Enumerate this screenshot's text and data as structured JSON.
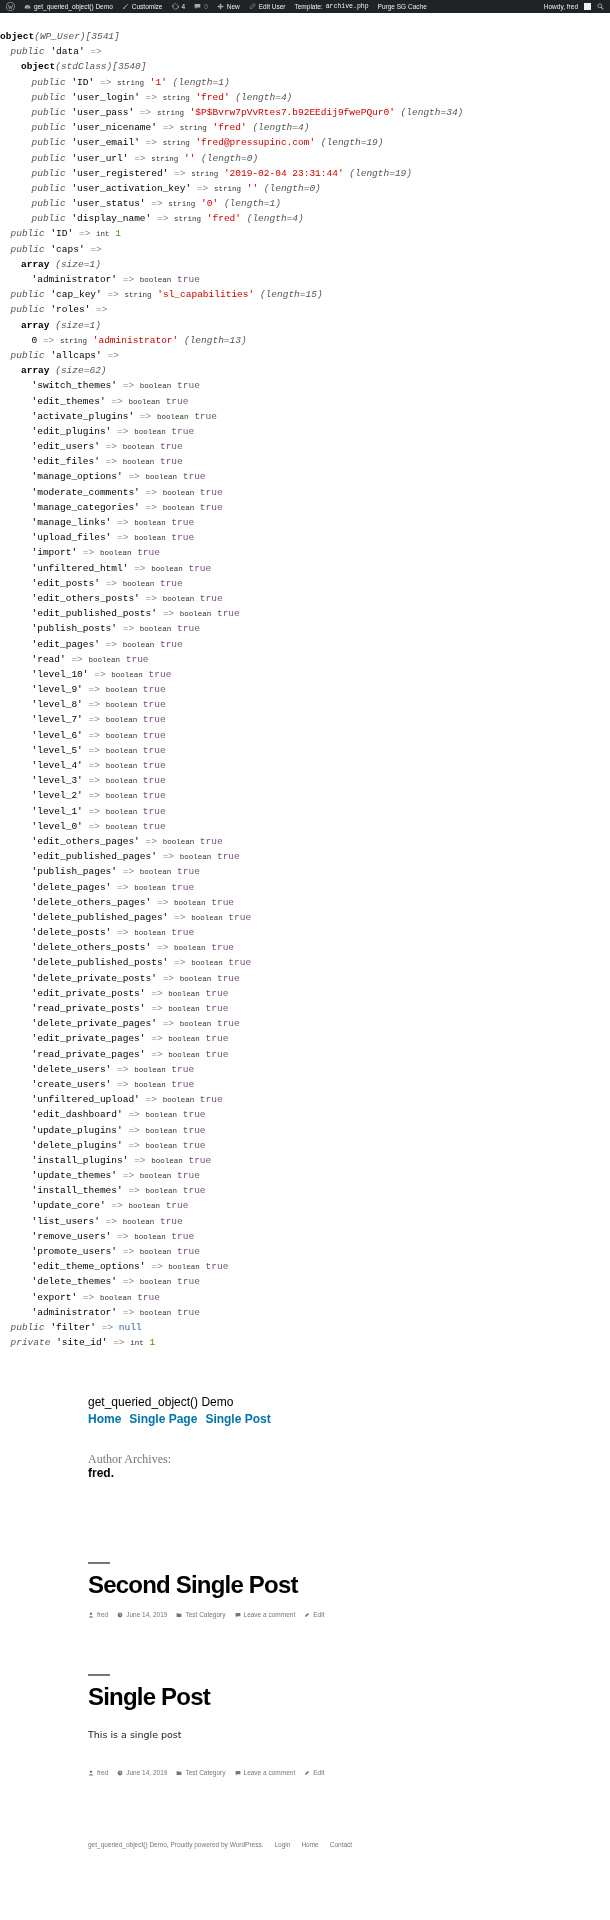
{
  "admin_bar": {
    "items": [
      {
        "kind": "logo"
      },
      {
        "kind": "site",
        "label": "get_queried_object() Demo"
      },
      {
        "kind": "customize",
        "label": "Customize"
      },
      {
        "kind": "updates",
        "label": "4"
      },
      {
        "kind": "comments",
        "label": "0"
      },
      {
        "kind": "new",
        "label": "New"
      },
      {
        "kind": "edit",
        "label": "Edit User"
      },
      {
        "kind": "template",
        "label": "Template:",
        "file": "archive.php"
      },
      {
        "kind": "purge",
        "label": "Purge SG Cache"
      }
    ],
    "greeting": "Howdy, fred"
  },
  "dump": [
    {
      "head": "object",
      "class": "(WP_User)",
      "ref": "[3541]",
      "children": [
        {
          "visibility": "public",
          "key": "'data'",
          "arrow": "=>",
          "children": [
            {
              "head": "object",
              "class": "(stdClass)",
              "ref": "[3540]",
              "children": [
                {
                  "visibility": "public",
                  "key": "'ID'",
                  "arrow": "=>",
                  "type": "string",
                  "value": "'1'",
                  "kind": "string",
                  "note": "(length=1)"
                },
                {
                  "visibility": "public",
                  "key": "'user_login'",
                  "arrow": "=>",
                  "type": "string",
                  "value": "'fred'",
                  "kind": "string",
                  "note": "(length=4)"
                },
                {
                  "visibility": "public",
                  "key": "'user_pass'",
                  "arrow": "=>",
                  "type": "string",
                  "value": "'$P$Bvrw7pVvRtes7.b92EEdij9fwePQur0'",
                  "kind": "string",
                  "note": "(length=34)"
                },
                {
                  "visibility": "public",
                  "key": "'user_nicename'",
                  "arrow": "=>",
                  "type": "string",
                  "value": "'fred'",
                  "kind": "string",
                  "note": "(length=4)"
                },
                {
                  "visibility": "public",
                  "key": "'user_email'",
                  "arrow": "=>",
                  "type": "string",
                  "value": "'fred@pressupinc.com'",
                  "kind": "string",
                  "note": "(length=19)"
                },
                {
                  "visibility": "public",
                  "key": "'user_url'",
                  "arrow": "=>",
                  "type": "string",
                  "value": "''",
                  "kind": "string",
                  "note": "(length=0)"
                },
                {
                  "visibility": "public",
                  "key": "'user_registered'",
                  "arrow": "=>",
                  "type": "string",
                  "value": "'2019-02-04 23:31:44'",
                  "kind": "string",
                  "note": "(length=19)"
                },
                {
                  "visibility": "public",
                  "key": "'user_activation_key'",
                  "arrow": "=>",
                  "type": "string",
                  "value": "''",
                  "kind": "string",
                  "note": "(length=0)"
                },
                {
                  "visibility": "public",
                  "key": "'user_status'",
                  "arrow": "=>",
                  "type": "string",
                  "value": "'0'",
                  "kind": "string",
                  "note": "(length=1)"
                },
                {
                  "visibility": "public",
                  "key": "'display_name'",
                  "arrow": "=>",
                  "type": "string",
                  "value": "'fred'",
                  "kind": "string",
                  "note": "(length=4)"
                }
              ]
            }
          ]
        },
        {
          "visibility": "public",
          "key": "'ID'",
          "arrow": "=>",
          "type": "int",
          "value": "1",
          "kind": "int"
        },
        {
          "visibility": "public",
          "key": "'caps'",
          "arrow": "=>",
          "children": [
            {
              "head": "array",
              "note": "(size=1)",
              "children": [
                {
                  "key": "'administrator'",
                  "arrow": "=>",
                  "type": "boolean",
                  "value": "true",
                  "kind": "bool"
                }
              ]
            }
          ]
        },
        {
          "visibility": "public",
          "key": "'cap_key'",
          "arrow": "=>",
          "type": "string",
          "value": "'sl_capabilities'",
          "kind": "string",
          "note": "(length=15)"
        },
        {
          "visibility": "public",
          "key": "'roles'",
          "arrow": "=>",
          "children": [
            {
              "head": "array",
              "note": "(size=1)",
              "children": [
                {
                  "key": "0",
                  "arrow": "=>",
                  "type": "string",
                  "value": "'administrator'",
                  "kind": "string",
                  "note": "(length=13)"
                }
              ]
            }
          ]
        },
        {
          "visibility": "public",
          "key": "'allcaps'",
          "arrow": "=>",
          "children": [
            {
              "head": "array",
              "note": "(size=62)",
              "children": [
                {
                  "key": "'switch_themes'",
                  "arrow": "=>",
                  "type": "boolean",
                  "value": "true",
                  "kind": "bool"
                },
                {
                  "key": "'edit_themes'",
                  "arrow": "=>",
                  "type": "boolean",
                  "value": "true",
                  "kind": "bool"
                },
                {
                  "key": "'activate_plugins'",
                  "arrow": "=>",
                  "type": "boolean",
                  "value": "true",
                  "kind": "bool"
                },
                {
                  "key": "'edit_plugins'",
                  "arrow": "=>",
                  "type": "boolean",
                  "value": "true",
                  "kind": "bool"
                },
                {
                  "key": "'edit_users'",
                  "arrow": "=>",
                  "type": "boolean",
                  "value": "true",
                  "kind": "bool"
                },
                {
                  "key": "'edit_files'",
                  "arrow": "=>",
                  "type": "boolean",
                  "value": "true",
                  "kind": "bool"
                },
                {
                  "key": "'manage_options'",
                  "arrow": "=>",
                  "type": "boolean",
                  "value": "true",
                  "kind": "bool"
                },
                {
                  "key": "'moderate_comments'",
                  "arrow": "=>",
                  "type": "boolean",
                  "value": "true",
                  "kind": "bool"
                },
                {
                  "key": "'manage_categories'",
                  "arrow": "=>",
                  "type": "boolean",
                  "value": "true",
                  "kind": "bool"
                },
                {
                  "key": "'manage_links'",
                  "arrow": "=>",
                  "type": "boolean",
                  "value": "true",
                  "kind": "bool"
                },
                {
                  "key": "'upload_files'",
                  "arrow": "=>",
                  "type": "boolean",
                  "value": "true",
                  "kind": "bool"
                },
                {
                  "key": "'import'",
                  "arrow": "=>",
                  "type": "boolean",
                  "value": "true",
                  "kind": "bool"
                },
                {
                  "key": "'unfiltered_html'",
                  "arrow": "=>",
                  "type": "boolean",
                  "value": "true",
                  "kind": "bool"
                },
                {
                  "key": "'edit_posts'",
                  "arrow": "=>",
                  "type": "boolean",
                  "value": "true",
                  "kind": "bool"
                },
                {
                  "key": "'edit_others_posts'",
                  "arrow": "=>",
                  "type": "boolean",
                  "value": "true",
                  "kind": "bool"
                },
                {
                  "key": "'edit_published_posts'",
                  "arrow": "=>",
                  "type": "boolean",
                  "value": "true",
                  "kind": "bool"
                },
                {
                  "key": "'publish_posts'",
                  "arrow": "=>",
                  "type": "boolean",
                  "value": "true",
                  "kind": "bool"
                },
                {
                  "key": "'edit_pages'",
                  "arrow": "=>",
                  "type": "boolean",
                  "value": "true",
                  "kind": "bool"
                },
                {
                  "key": "'read'",
                  "arrow": "=>",
                  "type": "boolean",
                  "value": "true",
                  "kind": "bool"
                },
                {
                  "key": "'level_10'",
                  "arrow": "=>",
                  "type": "boolean",
                  "value": "true",
                  "kind": "bool"
                },
                {
                  "key": "'level_9'",
                  "arrow": "=>",
                  "type": "boolean",
                  "value": "true",
                  "kind": "bool"
                },
                {
                  "key": "'level_8'",
                  "arrow": "=>",
                  "type": "boolean",
                  "value": "true",
                  "kind": "bool"
                },
                {
                  "key": "'level_7'",
                  "arrow": "=>",
                  "type": "boolean",
                  "value": "true",
                  "kind": "bool"
                },
                {
                  "key": "'level_6'",
                  "arrow": "=>",
                  "type": "boolean",
                  "value": "true",
                  "kind": "bool"
                },
                {
                  "key": "'level_5'",
                  "arrow": "=>",
                  "type": "boolean",
                  "value": "true",
                  "kind": "bool"
                },
                {
                  "key": "'level_4'",
                  "arrow": "=>",
                  "type": "boolean",
                  "value": "true",
                  "kind": "bool"
                },
                {
                  "key": "'level_3'",
                  "arrow": "=>",
                  "type": "boolean",
                  "value": "true",
                  "kind": "bool"
                },
                {
                  "key": "'level_2'",
                  "arrow": "=>",
                  "type": "boolean",
                  "value": "true",
                  "kind": "bool"
                },
                {
                  "key": "'level_1'",
                  "arrow": "=>",
                  "type": "boolean",
                  "value": "true",
                  "kind": "bool"
                },
                {
                  "key": "'level_0'",
                  "arrow": "=>",
                  "type": "boolean",
                  "value": "true",
                  "kind": "bool"
                },
                {
                  "key": "'edit_others_pages'",
                  "arrow": "=>",
                  "type": "boolean",
                  "value": "true",
                  "kind": "bool"
                },
                {
                  "key": "'edit_published_pages'",
                  "arrow": "=>",
                  "type": "boolean",
                  "value": "true",
                  "kind": "bool"
                },
                {
                  "key": "'publish_pages'",
                  "arrow": "=>",
                  "type": "boolean",
                  "value": "true",
                  "kind": "bool"
                },
                {
                  "key": "'delete_pages'",
                  "arrow": "=>",
                  "type": "boolean",
                  "value": "true",
                  "kind": "bool"
                },
                {
                  "key": "'delete_others_pages'",
                  "arrow": "=>",
                  "type": "boolean",
                  "value": "true",
                  "kind": "bool"
                },
                {
                  "key": "'delete_published_pages'",
                  "arrow": "=>",
                  "type": "boolean",
                  "value": "true",
                  "kind": "bool"
                },
                {
                  "key": "'delete_posts'",
                  "arrow": "=>",
                  "type": "boolean",
                  "value": "true",
                  "kind": "bool"
                },
                {
                  "key": "'delete_others_posts'",
                  "arrow": "=>",
                  "type": "boolean",
                  "value": "true",
                  "kind": "bool"
                },
                {
                  "key": "'delete_published_posts'",
                  "arrow": "=>",
                  "type": "boolean",
                  "value": "true",
                  "kind": "bool"
                },
                {
                  "key": "'delete_private_posts'",
                  "arrow": "=>",
                  "type": "boolean",
                  "value": "true",
                  "kind": "bool"
                },
                {
                  "key": "'edit_private_posts'",
                  "arrow": "=>",
                  "type": "boolean",
                  "value": "true",
                  "kind": "bool"
                },
                {
                  "key": "'read_private_posts'",
                  "arrow": "=>",
                  "type": "boolean",
                  "value": "true",
                  "kind": "bool"
                },
                {
                  "key": "'delete_private_pages'",
                  "arrow": "=>",
                  "type": "boolean",
                  "value": "true",
                  "kind": "bool"
                },
                {
                  "key": "'edit_private_pages'",
                  "arrow": "=>",
                  "type": "boolean",
                  "value": "true",
                  "kind": "bool"
                },
                {
                  "key": "'read_private_pages'",
                  "arrow": "=>",
                  "type": "boolean",
                  "value": "true",
                  "kind": "bool"
                },
                {
                  "key": "'delete_users'",
                  "arrow": "=>",
                  "type": "boolean",
                  "value": "true",
                  "kind": "bool"
                },
                {
                  "key": "'create_users'",
                  "arrow": "=>",
                  "type": "boolean",
                  "value": "true",
                  "kind": "bool"
                },
                {
                  "key": "'unfiltered_upload'",
                  "arrow": "=>",
                  "type": "boolean",
                  "value": "true",
                  "kind": "bool"
                },
                {
                  "key": "'edit_dashboard'",
                  "arrow": "=>",
                  "type": "boolean",
                  "value": "true",
                  "kind": "bool"
                },
                {
                  "key": "'update_plugins'",
                  "arrow": "=>",
                  "type": "boolean",
                  "value": "true",
                  "kind": "bool"
                },
                {
                  "key": "'delete_plugins'",
                  "arrow": "=>",
                  "type": "boolean",
                  "value": "true",
                  "kind": "bool"
                },
                {
                  "key": "'install_plugins'",
                  "arrow": "=>",
                  "type": "boolean",
                  "value": "true",
                  "kind": "bool"
                },
                {
                  "key": "'update_themes'",
                  "arrow": "=>",
                  "type": "boolean",
                  "value": "true",
                  "kind": "bool"
                },
                {
                  "key": "'install_themes'",
                  "arrow": "=>",
                  "type": "boolean",
                  "value": "true",
                  "kind": "bool"
                },
                {
                  "key": "'update_core'",
                  "arrow": "=>",
                  "type": "boolean",
                  "value": "true",
                  "kind": "bool"
                },
                {
                  "key": "'list_users'",
                  "arrow": "=>",
                  "type": "boolean",
                  "value": "true",
                  "kind": "bool"
                },
                {
                  "key": "'remove_users'",
                  "arrow": "=>",
                  "type": "boolean",
                  "value": "true",
                  "kind": "bool"
                },
                {
                  "key": "'promote_users'",
                  "arrow": "=>",
                  "type": "boolean",
                  "value": "true",
                  "kind": "bool"
                },
                {
                  "key": "'edit_theme_options'",
                  "arrow": "=>",
                  "type": "boolean",
                  "value": "true",
                  "kind": "bool"
                },
                {
                  "key": "'delete_themes'",
                  "arrow": "=>",
                  "type": "boolean",
                  "value": "true",
                  "kind": "bool"
                },
                {
                  "key": "'export'",
                  "arrow": "=>",
                  "type": "boolean",
                  "value": "true",
                  "kind": "bool"
                },
                {
                  "key": "'administrator'",
                  "arrow": "=>",
                  "type": "boolean",
                  "value": "true",
                  "kind": "bool"
                }
              ]
            }
          ]
        },
        {
          "visibility": "public",
          "key": "'filter'",
          "arrow": "=>",
          "value": "null",
          "kind": "null"
        },
        {
          "visibility": "private",
          "key": "'site_id'",
          "arrow": "=>",
          "type": "int",
          "value": "1",
          "kind": "int"
        }
      ]
    }
  ],
  "site": {
    "title": "get_queried_object() Demo",
    "nav": [
      "Home",
      "Single Page",
      "Single Post"
    ]
  },
  "archive": {
    "label": "Author Archives:",
    "name": "fred."
  },
  "posts": [
    {
      "title": "Second Single Post",
      "meta": [
        {
          "kind": "author",
          "label": "fred"
        },
        {
          "kind": "date",
          "label": "June 14, 2019"
        },
        {
          "kind": "category",
          "label": "Test Category"
        },
        {
          "kind": "comments",
          "label": "Leave a comment"
        },
        {
          "kind": "edit",
          "label": "Edit"
        }
      ]
    },
    {
      "title": "Single Post",
      "content": "This is a single post",
      "meta": [
        {
          "kind": "author",
          "label": "fred"
        },
        {
          "kind": "date",
          "label": "June 14, 2019"
        },
        {
          "kind": "category",
          "label": "Test Category"
        },
        {
          "kind": "comments",
          "label": "Leave a comment"
        },
        {
          "kind": "edit",
          "label": "Edit"
        }
      ]
    }
  ],
  "footer": {
    "text": "get_queried_object() Demo, Proudly powered by WordPress.",
    "links": [
      "Login",
      "Home",
      "Contact"
    ]
  }
}
